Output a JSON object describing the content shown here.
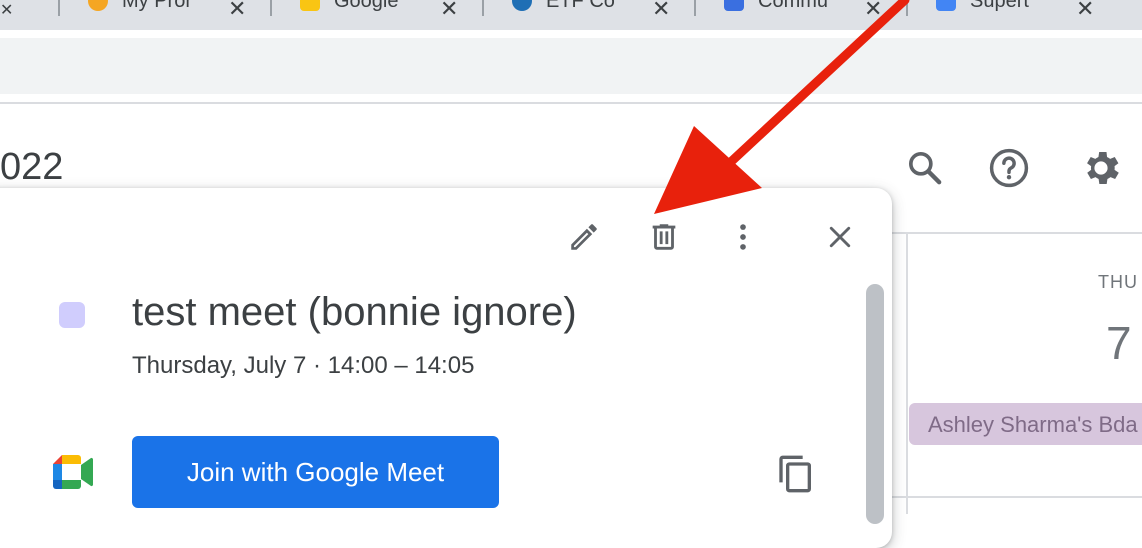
{
  "browser": {
    "tabs": [
      {
        "title": "My Pror",
        "favicon_color": "#f5a623"
      },
      {
        "title": "Google",
        "favicon_color": "#f9c513"
      },
      {
        "title": "ETF Co",
        "favicon_color": "#1f6fb5"
      },
      {
        "title": "Commu",
        "favicon_color": "#3a6fe0"
      },
      {
        "title": "Supert",
        "favicon_color": "#4285f4"
      }
    ],
    "close_glyph": "✕"
  },
  "header": {
    "year_fragment": "022",
    "icons": [
      "search-icon",
      "help-icon",
      "settings-icon"
    ]
  },
  "calendar": {
    "day_name": "THU",
    "day_number": "7",
    "allday_event": "Ashley Sharma's Bda",
    "allday_color": "#d7c6dd"
  },
  "popup": {
    "actions": [
      "edit-icon",
      "delete-icon",
      "more-options-icon",
      "close-icon"
    ],
    "event_title": "test meet (bonnie ignore)",
    "event_when": "Thursday, July 7 · 14:00 – 14:05",
    "event_color": "#d0cdfd",
    "join_label": "Join with Google Meet",
    "accent": "#1a73e8"
  },
  "annotation": {
    "arrow_color": "#e8210c"
  }
}
